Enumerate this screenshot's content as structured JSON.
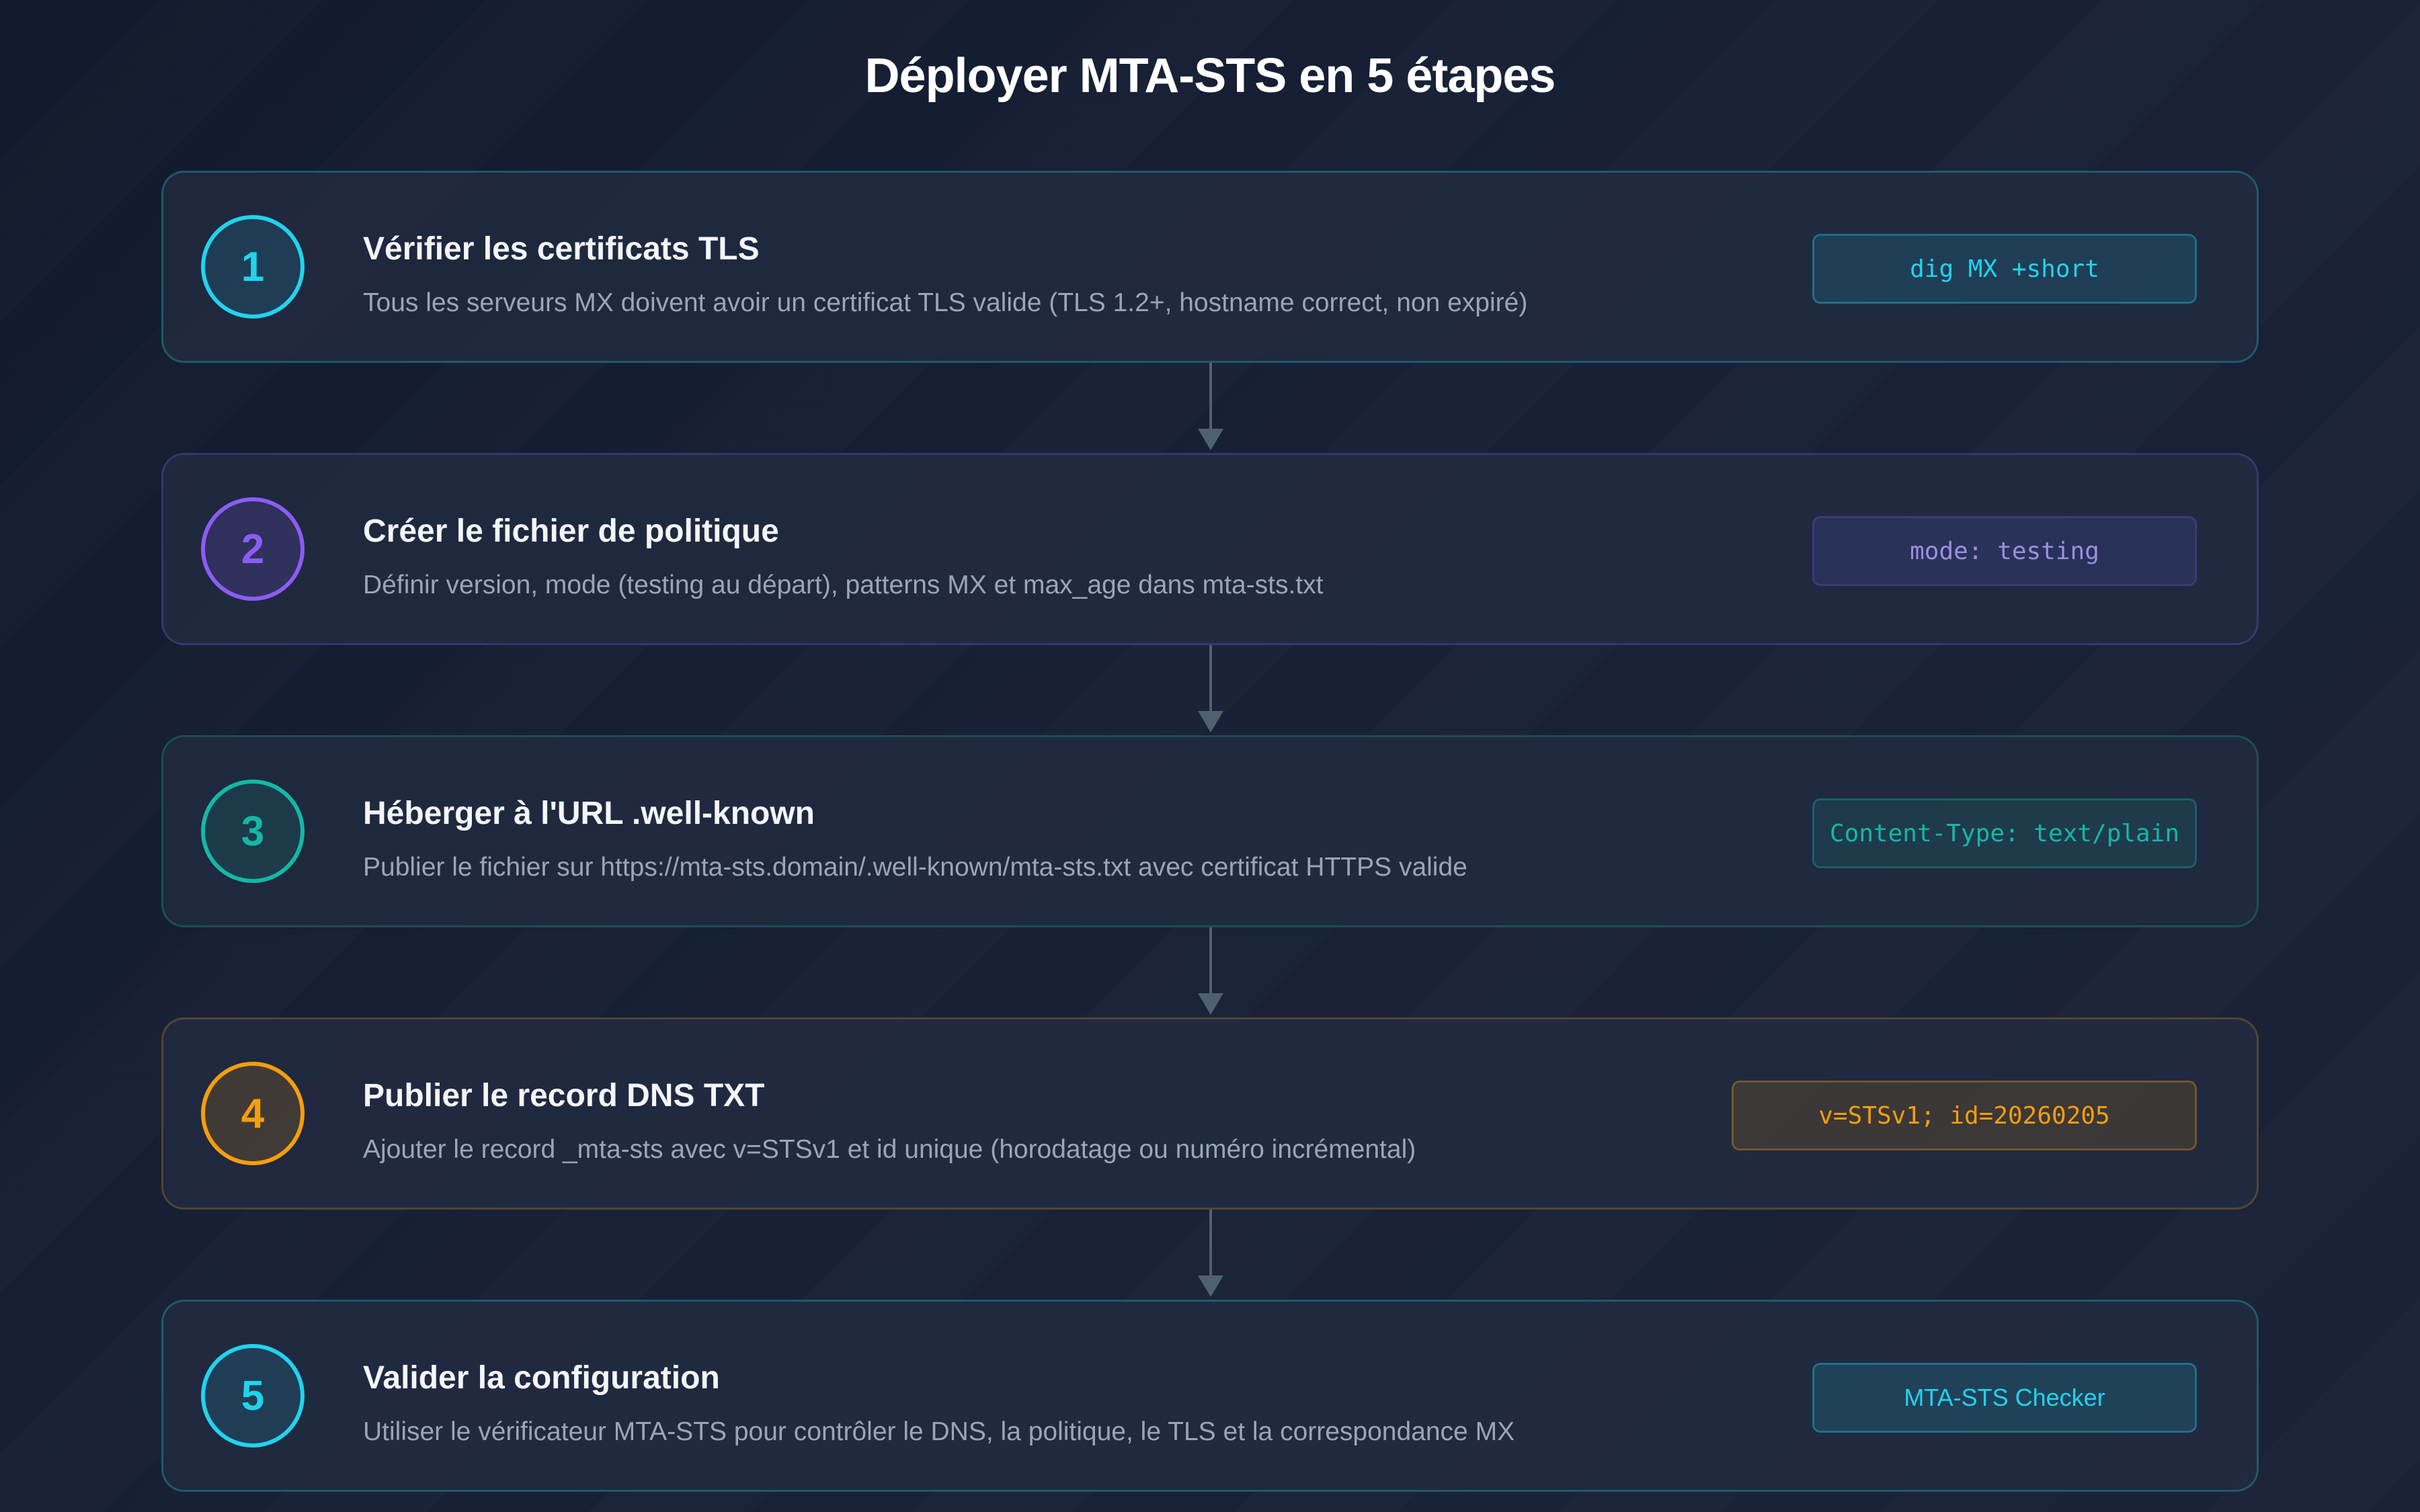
{
  "title": "Déployer MTA-STS en 5 étapes",
  "steps": [
    {
      "number": "1",
      "title": "Vérifier les certificats TLS",
      "description": "Tous les serveurs MX doivent avoir un certificat TLS valide (TLS 1.2+, hostname correct, non expiré)",
      "badge": "dig MX +short",
      "accent": "#22d3ee"
    },
    {
      "number": "2",
      "title": "Créer le fichier de politique",
      "description": "Définir version, mode (testing au départ), patterns MX et max_age dans mta-sts.txt",
      "badge": "mode: testing",
      "accent": "#8b5cf6"
    },
    {
      "number": "3",
      "title": "Héberger à l'URL .well-known",
      "description": "Publier le fichier sur https://mta-sts.domain/.well-known/mta-sts.txt avec certificat HTTPS valide",
      "badge": "Content-Type: text/plain",
      "accent": "#14b8a6"
    },
    {
      "number": "4",
      "title": "Publier le record DNS TXT",
      "description": "Ajouter le record _mta-sts avec v=STSv1 et id unique (horodatage ou numéro incrémental)",
      "badge": "v=STSv1; id=20260205",
      "accent": "#f59e0b"
    },
    {
      "number": "5",
      "title": "Valider la configuration",
      "description": "Utiliser le vérificateur MTA-STS pour contrôler le DNS, la politique, le TLS et la correspondance MX",
      "badge": "MTA-STS Checker",
      "accent": "#22d3ee"
    }
  ]
}
